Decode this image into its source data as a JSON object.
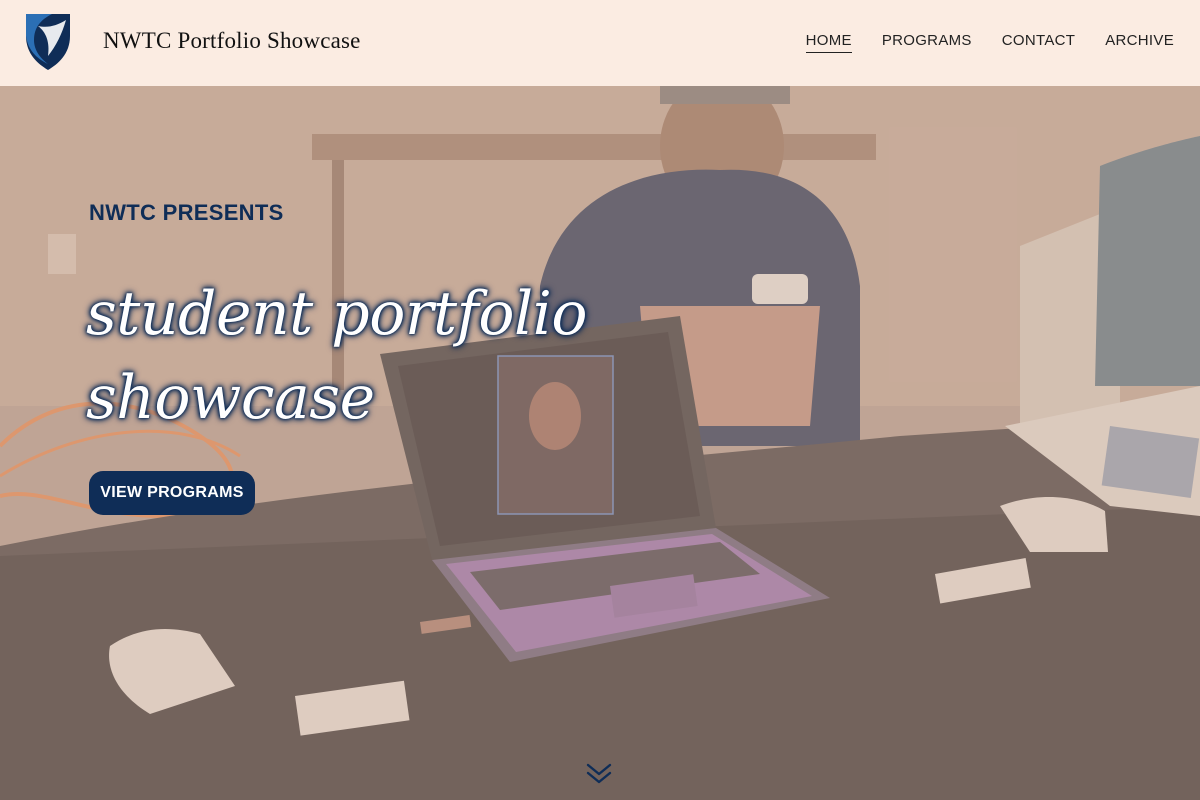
{
  "header": {
    "site_title": "NWTC Portfolio Showcase",
    "logo_icon": "shield-logo-icon",
    "nav": [
      {
        "label": "HOME",
        "active": true
      },
      {
        "label": "PROGRAMS",
        "active": false
      },
      {
        "label": "CONTACT",
        "active": false
      },
      {
        "label": "ARCHIVE",
        "active": false
      }
    ]
  },
  "hero": {
    "eyebrow": "NWTC PRESENTS",
    "title_line1": "student portfolio",
    "title_line2": "showcase",
    "cta_label": "VIEW PROGRAMS",
    "scroll_icon": "double-chevron-down-icon"
  },
  "colors": {
    "brand_navy": "#0f2d57",
    "header_bg": "#fbece2"
  }
}
